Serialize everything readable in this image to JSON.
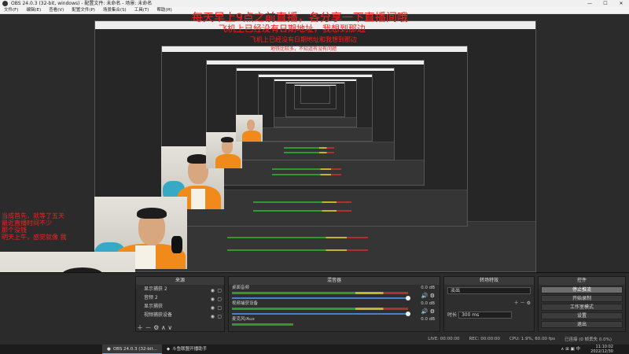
{
  "window": {
    "title": "OBS 24.0.3 (32-bit, windows) - 配置文件: 未命名 - 场景: 未命名",
    "buttons": [
      "—",
      "☐",
      "✕"
    ]
  },
  "menu": [
    "文件(F)",
    "编辑(E)",
    "查看(V)",
    "配置文件(P)",
    "场景集合(S)",
    "工具(T)",
    "帮助(H)"
  ],
  "overlays": {
    "line1": "每天早上9点之前直播，各分享一下直播间哦",
    "line2": "飞机上已经没有日期地址，我想到那边",
    "line3": "飞机上已经没有日期地址和我想到那边",
    "line4": "地铁比较多，不知道有没有问题",
    "left_block": [
      "当成首先，就等了五天",
      "最近直播时间不少",
      "那个没钱",
      "明天上午，感觉就像 我"
    ]
  },
  "dock": {
    "scenes_hint": "",
    "sources": {
      "title": "来源",
      "items": [
        "显示捕获 2",
        "音频 2",
        "显示捕获",
        "视频捕获设备"
      ]
    },
    "mixer": {
      "title": "混音器",
      "channels": [
        {
          "name": "桌面音频",
          "db": "0.0 dB"
        },
        {
          "name": "视频捕获设备",
          "db": "0.0 dB"
        },
        {
          "name": "麦克风/Aux",
          "db": "0.0 dB"
        }
      ]
    },
    "transitions": {
      "title": "转场特效",
      "type": "淡出",
      "duration_label": "时长",
      "duration": "300 ms"
    },
    "controls": {
      "title": "控件",
      "buttons": [
        "停止推流",
        "开始录制",
        "工作室模式",
        "设置",
        "退出"
      ]
    }
  },
  "status": {
    "live": "LIVE: 00:00:00",
    "rec": "REC: 00:00:00",
    "cpu": "CPU: 1.9%, 60.00 fps",
    "note": "已连接 (0 帧丢失 0.0%)"
  },
  "taskbar": {
    "items": [
      {
        "label": "OBS 24.0.3 (32-bit...",
        "active": true
      },
      {
        "label": "斗鱼联盟开播助手",
        "active": false
      }
    ],
    "tray": "∧  ⊞  ▣  中",
    "time": "11:10:02",
    "date": "2022/12/30"
  }
}
